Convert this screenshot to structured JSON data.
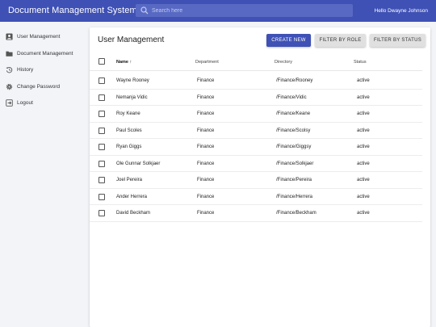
{
  "header": {
    "title": "Document Management System",
    "search_placeholder": "Search here",
    "greeting": "Hello Dwayne Johnson"
  },
  "sidebar": {
    "items": [
      {
        "label": "User Management",
        "icon": "account-box-icon"
      },
      {
        "label": "Document Management",
        "icon": "folder-icon"
      },
      {
        "label": "History",
        "icon": "history-icon"
      },
      {
        "label": "Change Password",
        "icon": "settings-icon"
      },
      {
        "label": "Logout",
        "icon": "logout-icon"
      }
    ]
  },
  "main": {
    "title": "User Management",
    "buttons": {
      "create": "CREATE NEW",
      "filter_role": "FILTER BY ROLE",
      "filter_status": "FILTER BY STATUS"
    },
    "columns": {
      "name": "Name",
      "sort_indicator": "↑",
      "department": "Department",
      "directory": "Directory",
      "status": "Status"
    },
    "rows": [
      {
        "name": "Wayne Rooney",
        "department": "Finance",
        "directory": "/Finance/Rooney",
        "status": "active"
      },
      {
        "name": "Nemanja Vidic",
        "department": "Finance",
        "directory": "/Finance/Vidic",
        "status": "active"
      },
      {
        "name": "Roy Keane",
        "department": "Finance",
        "directory": "/Finance/Keane",
        "status": "active"
      },
      {
        "name": "Paul Scoles",
        "department": "Finance",
        "directory": "/Finance/Scolsy",
        "status": "active"
      },
      {
        "name": "Ryan Giggs",
        "department": "Finance",
        "directory": "/Finance/Giggsy",
        "status": "active"
      },
      {
        "name": "Ole Gunnar Solkjaer",
        "department": "Finance",
        "directory": "/Finance/Solkjaer",
        "status": "active"
      },
      {
        "name": "Joel Pereira",
        "department": "Finance",
        "directory": "/Finance/Pereira",
        "status": "active"
      },
      {
        "name": "Ander Herrera",
        "department": "Finance",
        "directory": "/Finance/Herrera",
        "status": "active"
      },
      {
        "name": "David Beckham",
        "department": "Finance",
        "directory": "/Finance/Beckham",
        "status": "active"
      }
    ]
  },
  "colors": {
    "primary": "#3f51b5",
    "background": "#f3f4f8"
  }
}
